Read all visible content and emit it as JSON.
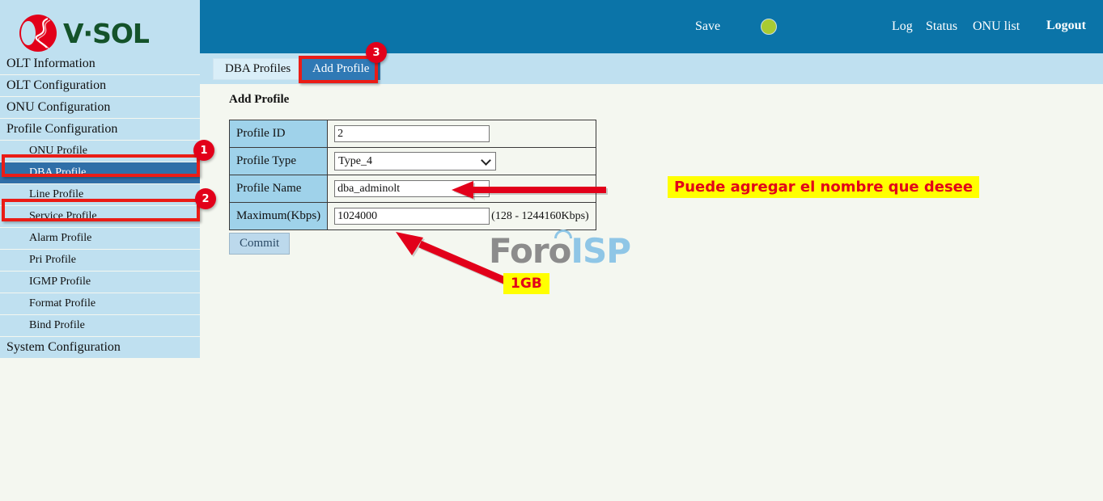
{
  "brand": {
    "logo_text": "V·SOL",
    "logo_icon": "vsol-circle-logo"
  },
  "header": {
    "save": "Save",
    "status_indicator": "green-status-dot",
    "log": "Log",
    "status": "Status",
    "onu_list": "ONU list",
    "logout": "Logout",
    "bg_color": "#0b74a8",
    "dot_color": "#a9cb33"
  },
  "tabs": [
    {
      "label": "DBA Profiles",
      "active": false
    },
    {
      "label": "Add Profile",
      "active": true
    }
  ],
  "sidebar": {
    "items": [
      {
        "label": "OLT Information",
        "sub": false,
        "active": false
      },
      {
        "label": "OLT Configuration",
        "sub": false,
        "active": false
      },
      {
        "label": "ONU Configuration",
        "sub": false,
        "active": false
      },
      {
        "label": "Profile Configuration",
        "sub": false,
        "active": false
      },
      {
        "label": "ONU Profile",
        "sub": true,
        "active": false
      },
      {
        "label": "DBA Profile",
        "sub": true,
        "active": true
      },
      {
        "label": "Line Profile",
        "sub": true,
        "active": false
      },
      {
        "label": "Service Profile",
        "sub": true,
        "active": false
      },
      {
        "label": "Alarm Profile",
        "sub": true,
        "active": false
      },
      {
        "label": "Pri Profile",
        "sub": true,
        "active": false
      },
      {
        "label": "IGMP Profile",
        "sub": true,
        "active": false
      },
      {
        "label": "Format Profile",
        "sub": true,
        "active": false
      },
      {
        "label": "Bind Profile",
        "sub": true,
        "active": false
      },
      {
        "label": "System Configuration",
        "sub": false,
        "active": false
      }
    ]
  },
  "main": {
    "page_title": "Add Profile",
    "form": {
      "profile_id": {
        "label": "Profile ID",
        "value": "2"
      },
      "profile_type": {
        "label": "Profile Type",
        "value": "Type_4"
      },
      "profile_name": {
        "label": "Profile Name",
        "value": "dba_adminolt"
      },
      "maximum": {
        "label": "Maximum(Kbps)",
        "value": "1024000",
        "range_note": "(128 - 1244160Kbps)"
      }
    },
    "commit_label": "Commit"
  },
  "watermark": {
    "part1": "Foro",
    "part2": "ISP"
  },
  "annotations": {
    "badge_1": "1",
    "badge_2": "2",
    "badge_3": "3",
    "note_name": "Puede agregar el nombre que desee",
    "note_size": "1GB",
    "highlight_color": "#ea1c16",
    "note_bg": "#ffff00",
    "note_fg": "#e2001a"
  }
}
